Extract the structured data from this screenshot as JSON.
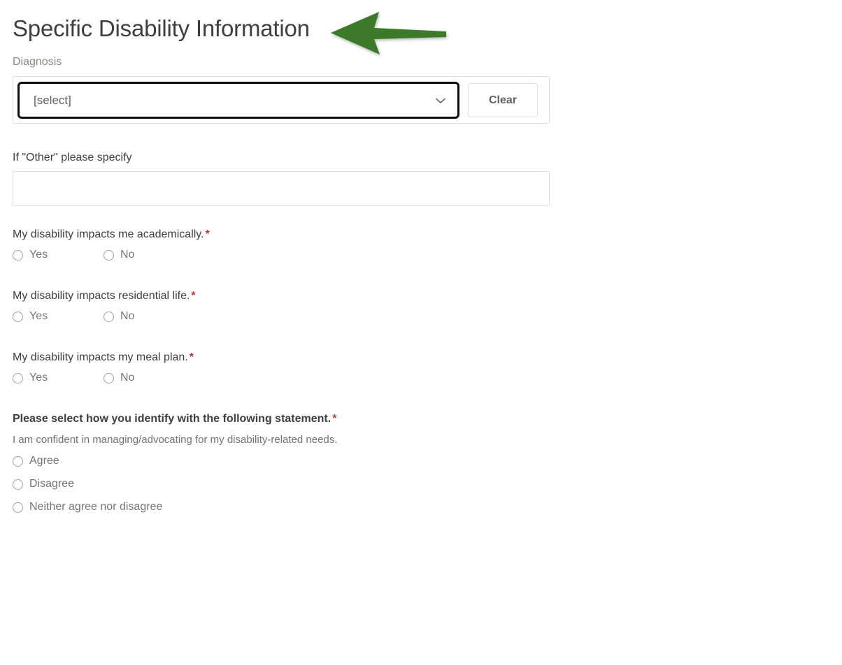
{
  "page": {
    "title": "Specific Disability Information",
    "arrow_color": "#3a7a28",
    "required_marker": "*",
    "required_color": "#c0392b"
  },
  "diagnosis": {
    "label": "Diagnosis",
    "selected_value": "[select]",
    "chevron_icon": "chevron-down-icon",
    "clear_label": "Clear"
  },
  "other_specify": {
    "label": "If \"Other\" please specify",
    "value": "",
    "placeholder": ""
  },
  "questions": [
    {
      "label": "My disability impacts me academically.",
      "required": true,
      "options": [
        "Yes",
        "No"
      ]
    },
    {
      "label": "My disability impacts residential life.",
      "required": true,
      "options": [
        "Yes",
        "No"
      ]
    },
    {
      "label": "My disability impacts my meal plan.",
      "required": true,
      "options": [
        "Yes",
        "No"
      ]
    }
  ],
  "statement_question": {
    "label": "Please select how you identify with the following statement.",
    "required": true,
    "statement": "I am confident in managing/advocating for my disability-related needs.",
    "options": [
      "Agree",
      "Disagree",
      "Neither agree nor disagree"
    ]
  }
}
